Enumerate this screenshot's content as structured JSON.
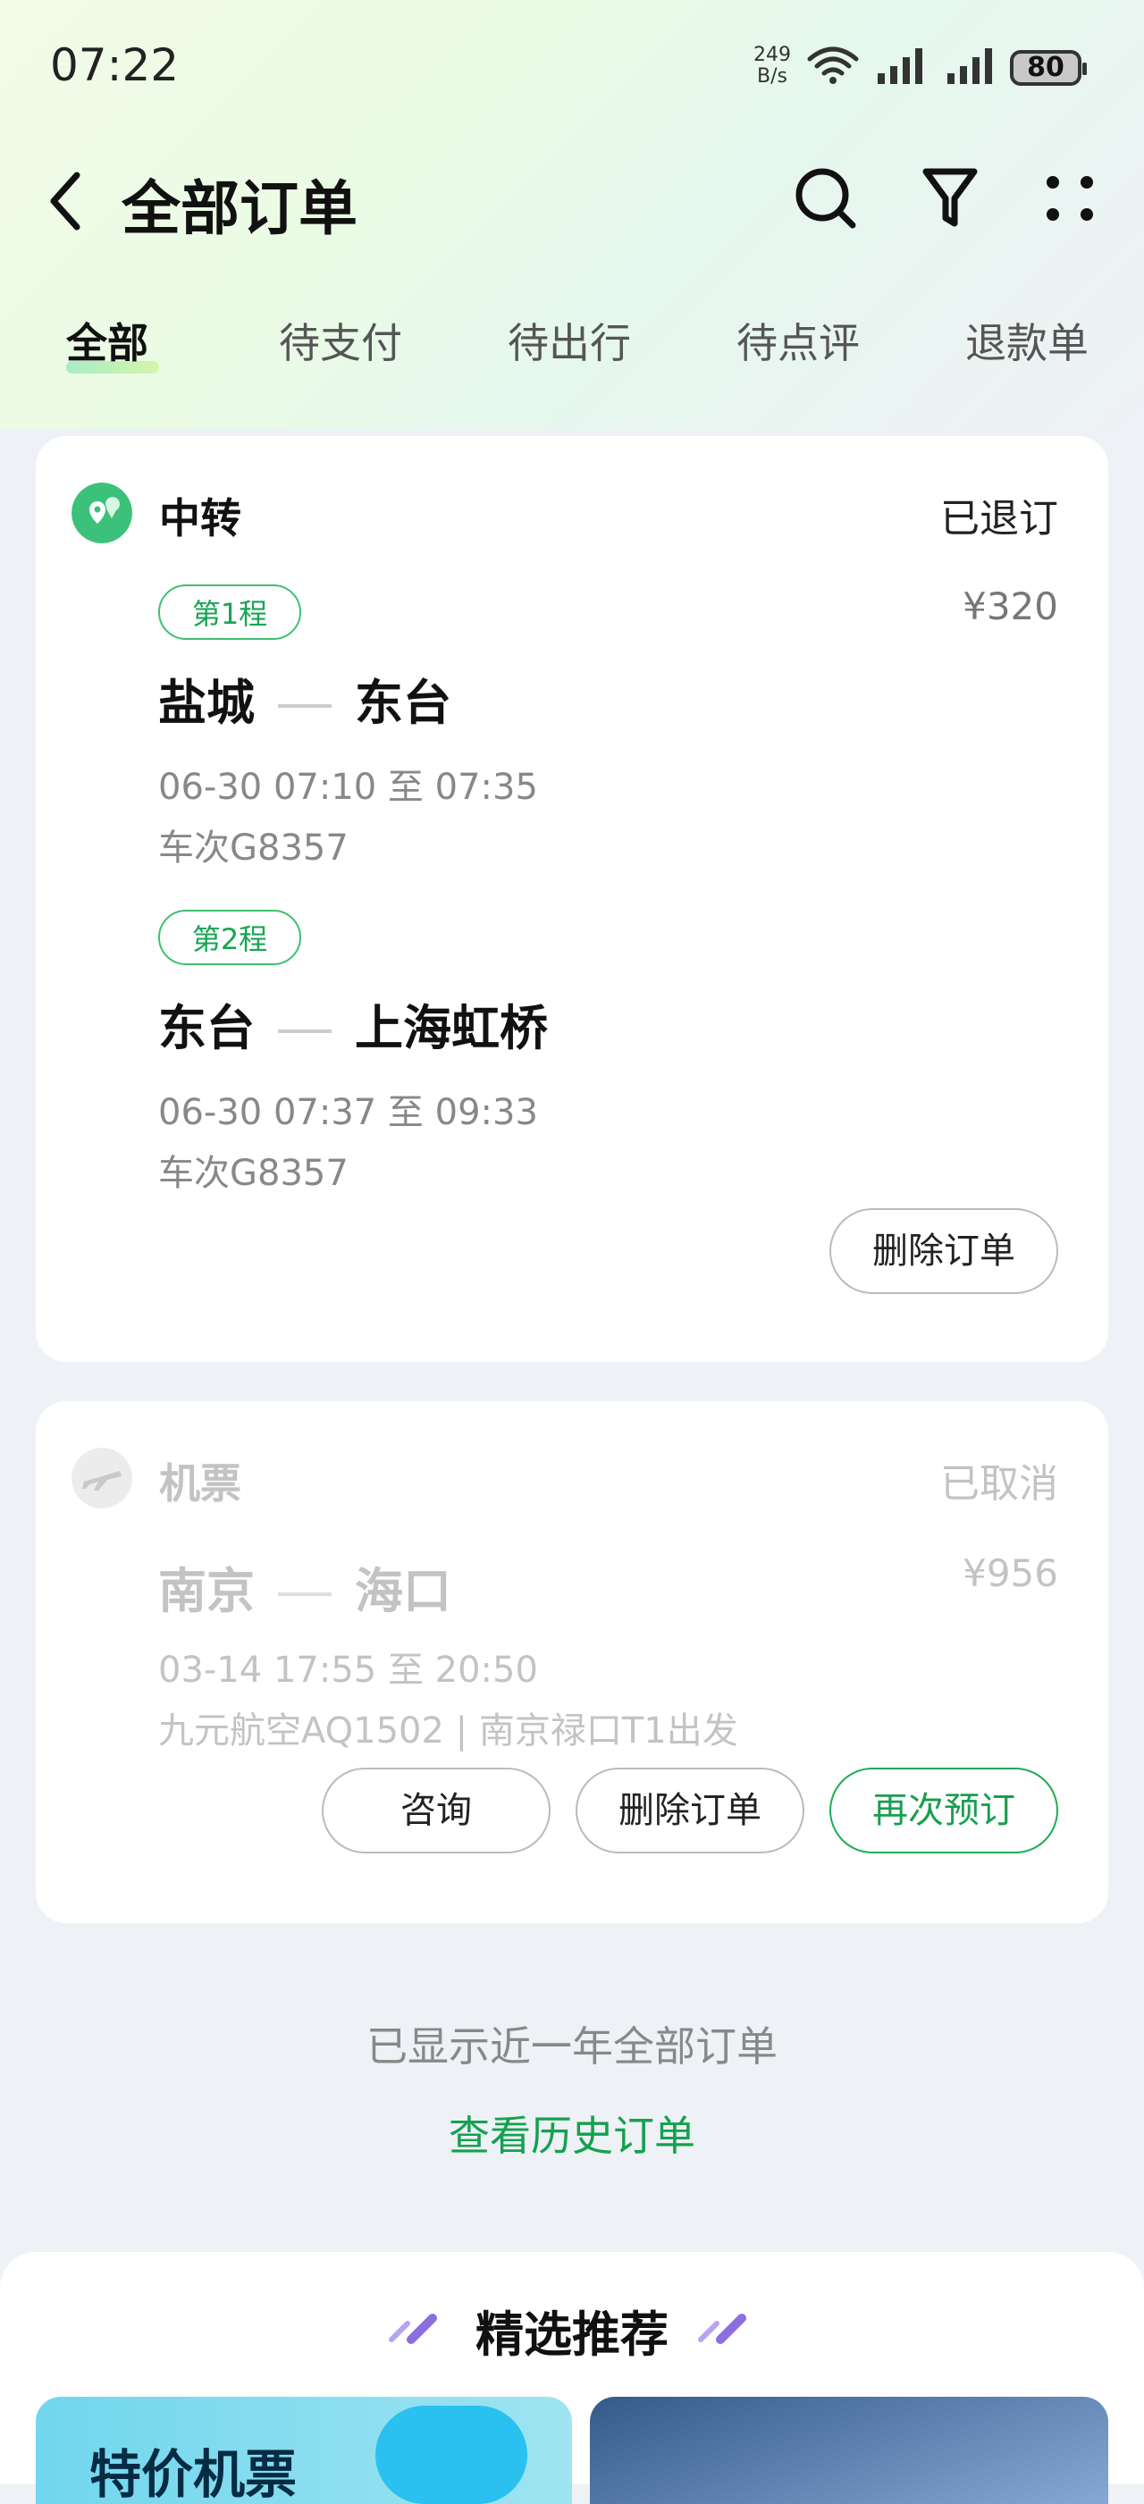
{
  "status_bar": {
    "time": "07:22",
    "net_speed_value": "249",
    "net_speed_unit": "B/s",
    "battery": "80"
  },
  "header": {
    "title": "全部订单"
  },
  "tabs": [
    "全部",
    "待支付",
    "待出行",
    "待点评",
    "退款单"
  ],
  "orders": [
    {
      "category": "中转",
      "status": "已退订",
      "price": "¥320",
      "legs": [
        {
          "tag": "第1程",
          "from": "盐城",
          "to": "东台",
          "time": "06-30 07:10 至 07:35",
          "train": "车次G8357"
        },
        {
          "tag": "第2程",
          "from": "东台",
          "to": "上海虹桥",
          "time": "06-30 07:37 至 09:33",
          "train": "车次G8357"
        }
      ],
      "buttons": [
        "删除订单"
      ]
    },
    {
      "category": "机票",
      "status": "已取消",
      "price": "¥956",
      "from": "南京",
      "to": "海口",
      "time": "03-14 17:55 至 20:50",
      "detail": "九元航空AQ1502 | 南京禄口T1出发",
      "buttons": [
        "咨询",
        "删除订单",
        "再次预订"
      ]
    }
  ],
  "footer": {
    "notice": "已显示近一年全部订单",
    "history_link": "查看历史订单"
  },
  "recommend": {
    "title": "精选推荐",
    "banner1_text": "特价机票"
  },
  "colors": {
    "accent_green": "#1a9e4f",
    "tag_green": "#3fc06f",
    "background": "#eef1f5"
  }
}
